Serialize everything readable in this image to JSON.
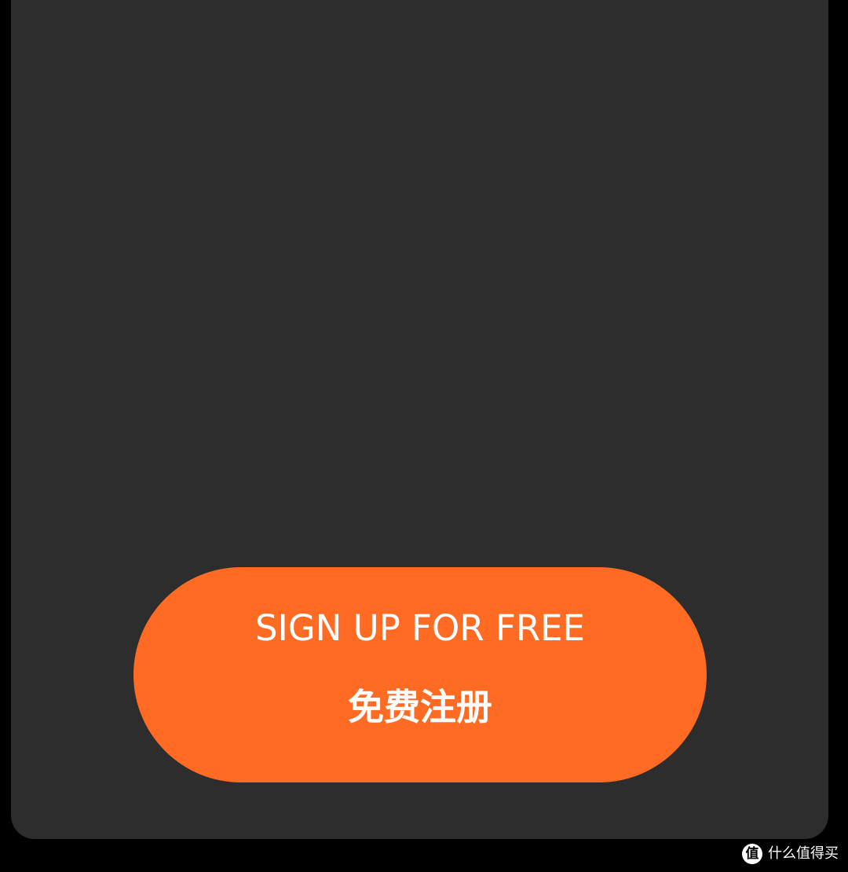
{
  "cta": {
    "label_en": "SIGN UP FOR FREE",
    "label_zh": "免费注册"
  },
  "watermark": {
    "logo_glyph": "值",
    "text": "什么值得买"
  },
  "colors": {
    "page_background": "#000000",
    "panel_background": "#2d2d2d",
    "button_background": "#ff6b22",
    "button_text": "#ffffff"
  }
}
